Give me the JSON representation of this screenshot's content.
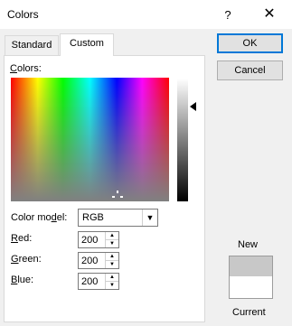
{
  "window": {
    "title": "Colors",
    "help": "?",
    "close": "✕"
  },
  "tabs": [
    "Standard",
    "Custom"
  ],
  "custom": {
    "colors_label": "Colors:",
    "color_model_label": "Color model:",
    "color_model_value": "RGB",
    "fields": [
      {
        "label": "Red:",
        "value": "200"
      },
      {
        "label": "Green:",
        "value": "200"
      },
      {
        "label": "Blue:",
        "value": "200"
      }
    ]
  },
  "buttons": {
    "ok": "OK",
    "cancel": "Cancel"
  },
  "preview": {
    "new_label": "New",
    "current_label": "Current",
    "new_color": "#c8c8c8",
    "current_color": "#ffffff"
  }
}
